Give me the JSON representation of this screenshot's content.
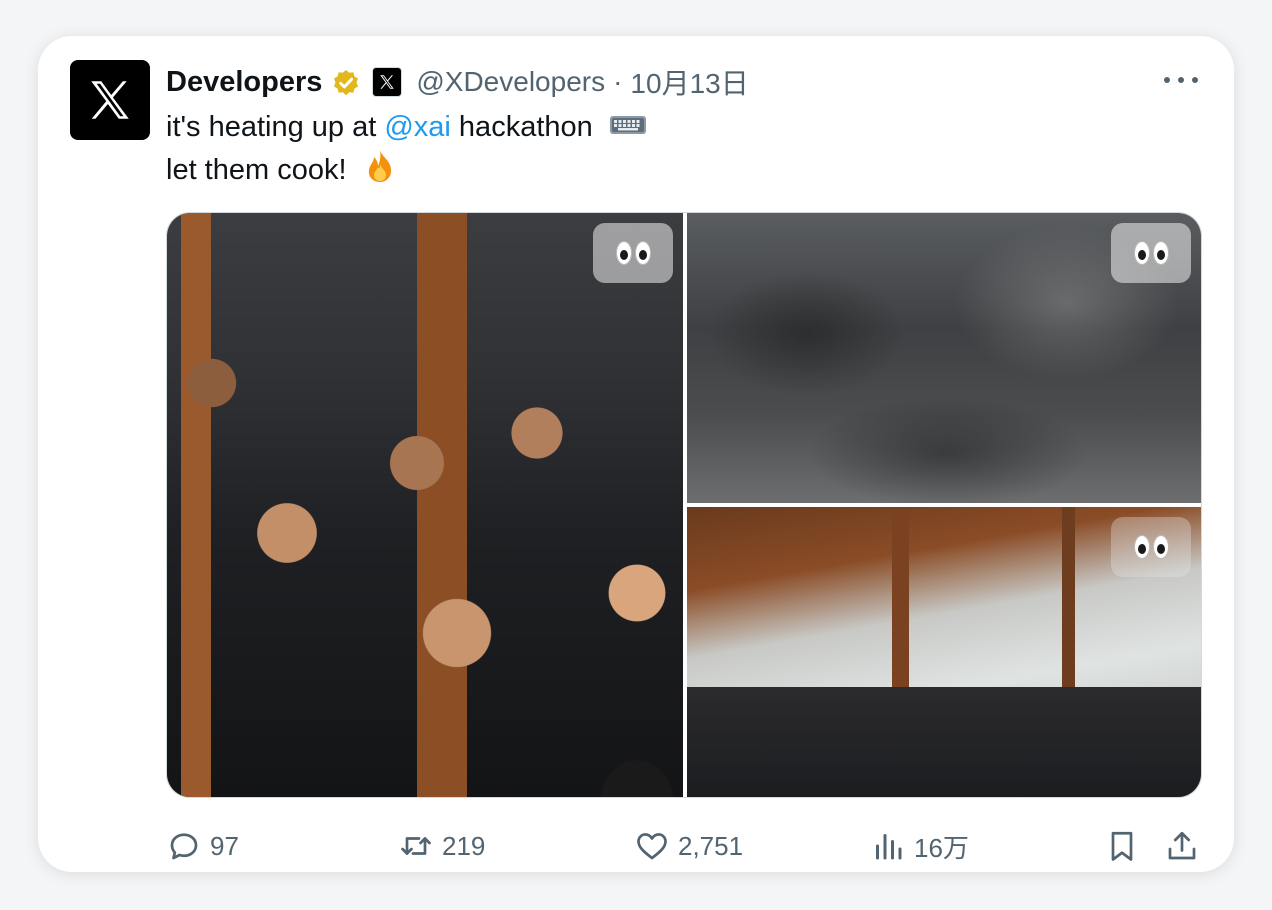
{
  "tweet": {
    "author_name": "Developers",
    "handle": "@XDevelopers",
    "separator": "·",
    "date": "10月13日",
    "text_line1_pre": "it's heating up at ",
    "mention": "@xai",
    "text_line1_post": " hackathon",
    "text_line2": "let them cook! ",
    "icons": {
      "avatar": "x-logo-icon",
      "verified": "verified-badge-icon",
      "affiliation": "x-affiliate-icon",
      "more": "more-icon",
      "keyboard": "keyboard-emoji-icon",
      "fire": "fire-emoji-icon"
    }
  },
  "media": {
    "photos": [
      {
        "name": "hackathon-group-selfie",
        "blurred": false,
        "label_icon": "eyes-emoji-icon"
      },
      {
        "name": "blurred-photo",
        "blurred": true,
        "label_icon": "eyes-emoji-icon"
      },
      {
        "name": "hackathon-venue-room",
        "blurred": false,
        "label_icon": "eyes-emoji-icon"
      }
    ]
  },
  "actions": {
    "replies": "97",
    "retweets": "219",
    "likes": "2,751",
    "views": "16万",
    "icons": [
      "reply-icon",
      "retweet-icon",
      "like-icon",
      "views-icon",
      "bookmark-icon",
      "share-icon"
    ]
  },
  "colors": {
    "text": "#0f1419",
    "secondary": "#536471",
    "link": "#1d9bf0",
    "verified": "#e2b719"
  }
}
